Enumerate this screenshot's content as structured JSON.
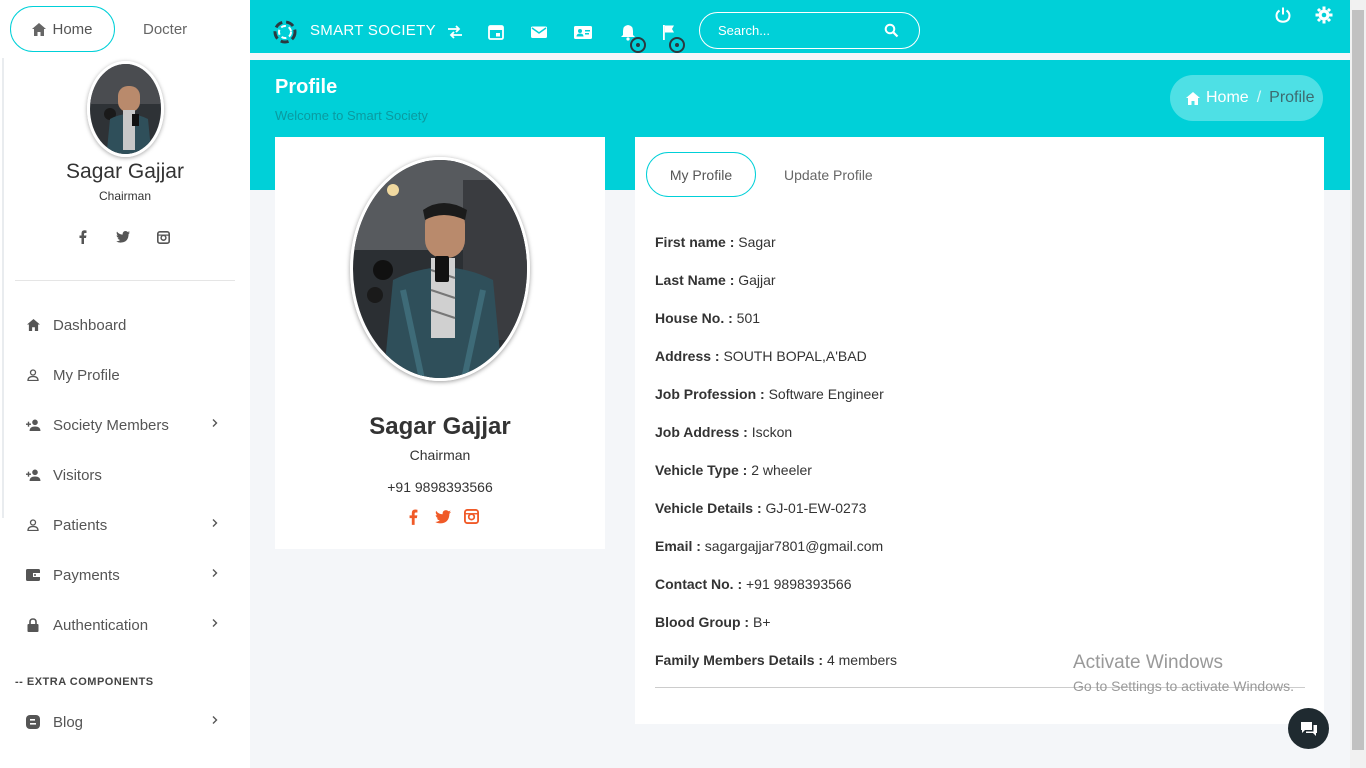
{
  "sidebar": {
    "tabs": {
      "home": "Home",
      "docter": "Docter"
    },
    "user": {
      "name": "Sagar Gajjar",
      "role": "Chairman"
    },
    "social": [
      "facebook-icon",
      "twitter-icon",
      "instagram-icon"
    ],
    "menu": [
      {
        "label": "Dashboard",
        "icon": "home-icon",
        "has_children": false
      },
      {
        "label": "My Profile",
        "icon": "user-icon",
        "has_children": false
      },
      {
        "label": "Society Members",
        "icon": "user-plus-icon",
        "has_children": true
      },
      {
        "label": "Visitors",
        "icon": "user-plus-icon",
        "has_children": false
      },
      {
        "label": "Patients",
        "icon": "user-icon",
        "has_children": true
      },
      {
        "label": "Payments",
        "icon": "wallet-icon",
        "has_children": true
      },
      {
        "label": "Authentication",
        "icon": "lock-icon",
        "has_children": true
      }
    ],
    "extra_label": "-- EXTRA COMPONENTS",
    "blog": {
      "label": "Blog",
      "icon": "blog-icon"
    }
  },
  "topbar": {
    "brand": "SMART SOCIETY",
    "search_placeholder": "Search...",
    "icons": [
      "swap-icon",
      "calendar-icon",
      "mail-icon",
      "contact-card-icon",
      "bell-icon",
      "flag-icon",
      "power-icon",
      "gear-icon"
    ]
  },
  "header": {
    "title": "Profile",
    "subtitle": "Welcome to Smart Society",
    "breadcrumb": {
      "home": "Home",
      "sep": "/",
      "current": "Profile"
    }
  },
  "profile_card": {
    "name": "Sagar Gajjar",
    "role": "Chairman",
    "phone": "+91 9898393566"
  },
  "details": {
    "tabs": {
      "active": "My Profile",
      "other": "Update Profile"
    },
    "fields": [
      {
        "label": "First name :",
        "value": "Sagar"
      },
      {
        "label": "Last Name :",
        "value": "Gajjar"
      },
      {
        "label": "House No. :",
        "value": "501"
      },
      {
        "label": "Address :",
        "value": "SOUTH BOPAL,A'BAD"
      },
      {
        "label": "Job Profession :",
        "value": "Software Engineer"
      },
      {
        "label": "Job Address :",
        "value": "Isckon"
      },
      {
        "label": "Vehicle Type :",
        "value": "2 wheeler"
      },
      {
        "label": "Vehicle Details :",
        "value": "GJ-01-EW-0273"
      },
      {
        "label": "Email :",
        "value": "sagargajjar7801@gmail.com"
      },
      {
        "label": "Contact No. :",
        "value": "+91 9898393566"
      },
      {
        "label": "Blood Group :",
        "value": "B+"
      },
      {
        "label": "Family Members Details :",
        "value": "4 members"
      }
    ]
  },
  "watermark": {
    "line1": "Activate Windows",
    "line2": "Go to Settings to activate Windows."
  },
  "colors": {
    "accent": "#00d0d8",
    "social": "#f05a28"
  }
}
